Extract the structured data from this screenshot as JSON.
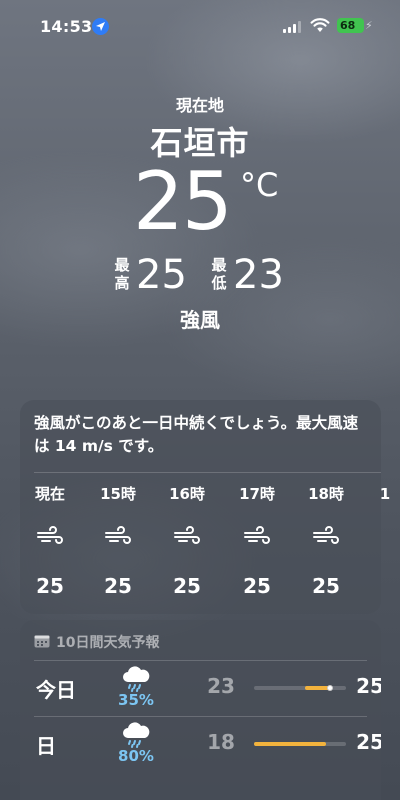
{
  "status_bar": {
    "time": "14:53",
    "battery": "68",
    "icons": [
      "location-arrow-icon",
      "cellular-signal-icon",
      "wifi-icon",
      "battery-icon"
    ]
  },
  "header": {
    "location_label": "現在地",
    "city": "石垣市",
    "temperature": "25",
    "unit": "°C",
    "high_label": "最高",
    "high": "25",
    "low_label": "最低",
    "low": "23",
    "condition": "強風"
  },
  "hourly": {
    "summary": "強風がこのあと一日中続くでしょう。最大風速は 14 m/s です。",
    "hours": [
      {
        "label": "現在",
        "icon": "wind-icon",
        "temp": "25"
      },
      {
        "label": "15時",
        "icon": "wind-icon",
        "temp": "25"
      },
      {
        "label": "16時",
        "icon": "wind-icon",
        "temp": "25"
      },
      {
        "label": "17時",
        "icon": "wind-icon",
        "temp": "25"
      },
      {
        "label": "18時",
        "icon": "wind-icon",
        "temp": "25"
      },
      {
        "label": "1",
        "icon": "",
        "temp": ""
      }
    ]
  },
  "daily": {
    "title": "10日間天気予報",
    "days": [
      {
        "name": "今日",
        "icon": "rain-cloud-icon",
        "pop": "35%",
        "low": "23",
        "high": "25",
        "range_start": 0.55,
        "range_end": 0.85,
        "current": 0.83
      },
      {
        "name": "日",
        "icon": "rain-cloud-icon",
        "pop": "80%",
        "low": "18",
        "high": "25",
        "range_start": 0.0,
        "range_end": 0.78,
        "current": null
      }
    ]
  },
  "colors": {
    "accent_location": "#2f7cf6",
    "battery": "#41c450",
    "precipitation": "#7cc5f2",
    "range_bar": "#f3b33d"
  }
}
